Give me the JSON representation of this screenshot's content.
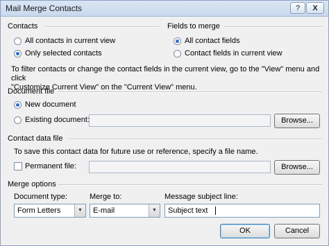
{
  "window": {
    "title": "Mail Merge Contacts",
    "help_label": "?",
    "close_label": "X"
  },
  "contacts": {
    "heading": "Contacts",
    "options": [
      {
        "label": "All contacts in current view",
        "selected": false
      },
      {
        "label": "Only selected contacts",
        "selected": true
      }
    ]
  },
  "fields": {
    "heading": "Fields to merge",
    "options": [
      {
        "label": "All contact fields",
        "selected": true
      },
      {
        "label": "Contact fields in current view",
        "selected": false
      }
    ]
  },
  "filter_info": {
    "line1": "To filter contacts or change the contact fields in the current view, go to the \"View\" menu and click",
    "line2": "\"Customize Current View\" on the \"Current View\" menu."
  },
  "document_file": {
    "heading": "Document file",
    "new_document_label": "New document",
    "existing_document_label": "Existing document:",
    "existing_document_value": "",
    "browse_label": "Browse..."
  },
  "contact_data_file": {
    "heading": "Contact data file",
    "info": "To save this contact data for future use or reference, specify a file name.",
    "permanent_file_label": "Permanent file:",
    "permanent_file_value": "",
    "permanent_file_checked": false,
    "browse_label": "Browse..."
  },
  "merge_options": {
    "heading": "Merge options",
    "document_type_label": "Document type:",
    "document_type_value": "Form Letters",
    "merge_to_label": "Merge to:",
    "merge_to_value": "E-mail",
    "subject_label": "Message subject line:",
    "subject_value": "Subject text"
  },
  "footer": {
    "ok_label": "OK",
    "cancel_label": "Cancel"
  }
}
